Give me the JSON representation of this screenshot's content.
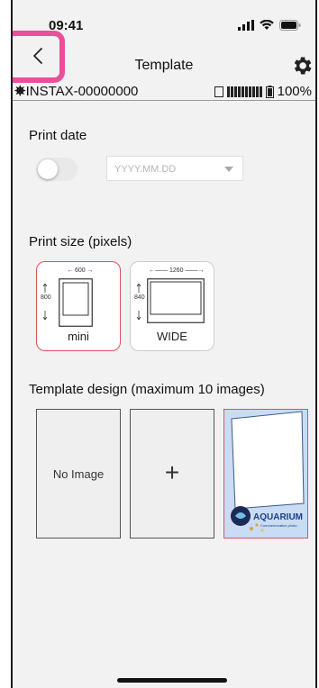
{
  "status_bar": {
    "time": "09:41"
  },
  "nav": {
    "title": "Template"
  },
  "device": {
    "name": "INSTAX-00000000",
    "battery_percent": "100%"
  },
  "print_date": {
    "label": "Print date",
    "toggle_on": false,
    "date_placeholder": "YYYY.MM.DD"
  },
  "print_size": {
    "label": "Print size (pixels)",
    "options": [
      {
        "label": "mini",
        "width": "600",
        "height": "800",
        "selected": true
      },
      {
        "label": "WIDE",
        "width": "1260",
        "height": "840",
        "selected": false
      }
    ]
  },
  "template_design": {
    "label": "Template design (maximum 10 images)",
    "tiles": [
      {
        "kind": "empty",
        "text": "No Image"
      },
      {
        "kind": "add",
        "text": "+"
      },
      {
        "kind": "image",
        "brand": "AQUARIUM",
        "caption": "Commemorative photo",
        "selected": true
      }
    ]
  },
  "colors": {
    "accent": "#e0505a",
    "highlight": "#e8509a",
    "background": "#f2f2f2"
  }
}
